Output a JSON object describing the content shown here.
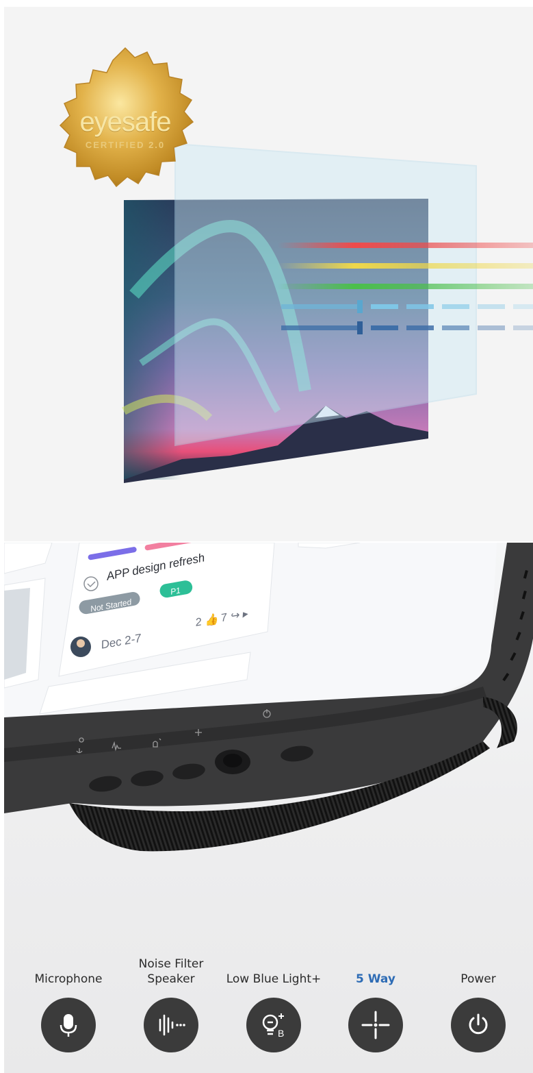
{
  "badge": {
    "brand": "eyesafe",
    "subtitle": "CERTIFIED 2.0"
  },
  "light_rays": {
    "colors": [
      "#ef4b4b",
      "#efd84a",
      "#4bbf4b",
      "#7fc6e6",
      "#3f6fa8"
    ]
  },
  "task_card": {
    "title": "APP design refresh",
    "status": "Not Started",
    "priority": "P1",
    "dates": "Dec 2-7",
    "likes": "2",
    "shares": "7"
  },
  "controls": [
    {
      "label": "Microphone",
      "icon": "microphone-icon",
      "active": false
    },
    {
      "label": "Noise Filter\nSpeaker",
      "icon": "noise-filter-icon",
      "active": false
    },
    {
      "label": "Low Blue Light+",
      "icon": "low-blue-light-icon",
      "active": false
    },
    {
      "label": "5 Way",
      "icon": "five-way-icon",
      "active": true
    },
    {
      "label": "Power",
      "icon": "power-icon",
      "active": false
    }
  ],
  "colors": {
    "active_label": "#2e6cb5",
    "button_bg": "#3b3b3b",
    "gold": "#d4a63a"
  }
}
